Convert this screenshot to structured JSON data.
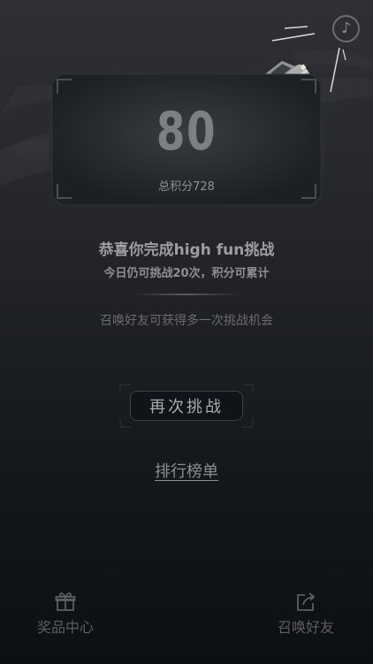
{
  "music": {
    "icon": "music-note-icon",
    "glyph": "♪"
  },
  "score": {
    "value": "80",
    "total_label": "总积分728"
  },
  "messages": {
    "congrats": "恭喜你完成high fun挑战",
    "remaining": "今日仍可挑战20次，积分可累计",
    "invite_hint": "召唤好友可获得多一次挑战机会"
  },
  "actions": {
    "retry_label": "再次挑战",
    "leaderboard_label": "排行榜单"
  },
  "bottom_nav": {
    "prizes": {
      "label": "奖品中心",
      "icon": "gift-icon"
    },
    "invite": {
      "label": "召唤好友",
      "icon": "share-icon"
    }
  }
}
